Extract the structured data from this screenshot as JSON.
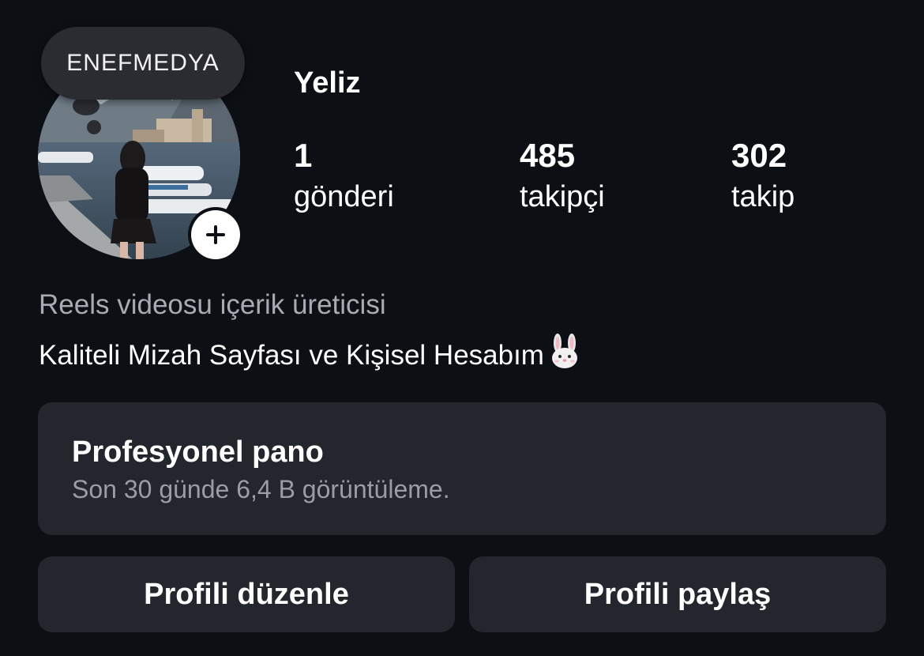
{
  "note": {
    "text": "ENEFMEDYA"
  },
  "profile": {
    "username": "Yeliz",
    "stats": [
      {
        "value": "1",
        "label": "gönderi"
      },
      {
        "value": "485",
        "label": "takipçi"
      },
      {
        "value": "302",
        "label": "takip"
      }
    ],
    "bio": {
      "category": "Reels videosu içerik üreticisi",
      "text": "Kaliteli Mizah Sayfası ve Kişisel Hesabım",
      "emoji_icon": "rabbit-face-icon"
    }
  },
  "dashboard": {
    "title": "Profesyonel pano",
    "subtitle": "Son 30 günde 6,4 B görüntüleme."
  },
  "actions": {
    "edit_label": "Profili düzenle",
    "share_label": "Profili paylaş"
  },
  "icons": {
    "add_story": "plus-icon"
  },
  "colors": {
    "background": "#0c0f14",
    "card": "#23262c",
    "secondary_text": "#a8abb3"
  }
}
